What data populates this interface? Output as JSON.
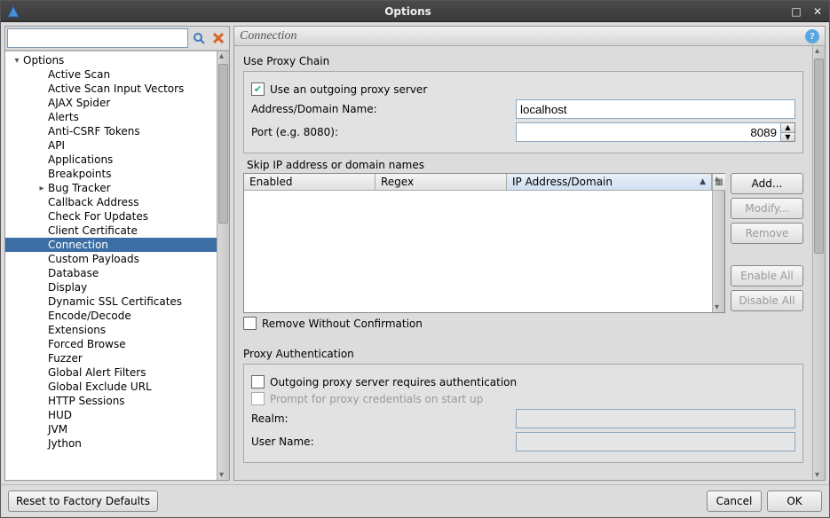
{
  "window": {
    "title": "Options"
  },
  "search": {
    "placeholder": ""
  },
  "tree": {
    "root": "Options",
    "items": [
      "Active Scan",
      "Active Scan Input Vectors",
      "AJAX Spider",
      "Alerts",
      "Anti-CSRF Tokens",
      "API",
      "Applications",
      "Breakpoints",
      "Bug Tracker",
      "Callback Address",
      "Check For Updates",
      "Client Certificate",
      "Connection",
      "Custom Payloads",
      "Database",
      "Display",
      "Dynamic SSL Certificates",
      "Encode/Decode",
      "Extensions",
      "Forced Browse",
      "Fuzzer",
      "Global Alert Filters",
      "Global Exclude URL",
      "HTTP Sessions",
      "HUD",
      "JVM",
      "Jython"
    ],
    "selected_index": 12,
    "expandable_index": 8
  },
  "panel": {
    "title": "Connection"
  },
  "proxy_chain": {
    "group": "Use Proxy Chain",
    "use_label": "Use an outgoing proxy server",
    "use_checked": true,
    "address_label": "Address/Domain Name:",
    "address_value": "localhost",
    "port_label": "Port (e.g. 8080):",
    "port_value": "8089",
    "skip_group": "Skip IP address or domain names",
    "columns": {
      "enabled": "Enabled",
      "regex": "Regex",
      "domain": "IP Address/Domain"
    },
    "buttons": {
      "add": "Add...",
      "modify": "Modify...",
      "remove": "Remove",
      "enable_all": "Enable All",
      "disable_all": "Disable All"
    },
    "remove_no_confirm_label": "Remove Without Confirmation",
    "remove_no_confirm_checked": false
  },
  "proxy_auth": {
    "group": "Proxy Authentication",
    "requires_label": "Outgoing proxy server requires authentication",
    "requires_checked": false,
    "prompt_label": "Prompt for proxy credentials on start up",
    "prompt_checked": false,
    "realm_label": "Realm:",
    "realm_value": "",
    "user_label": "User Name:",
    "user_value": ""
  },
  "footer": {
    "reset": "Reset to Factory Defaults",
    "cancel": "Cancel",
    "ok": "OK"
  }
}
